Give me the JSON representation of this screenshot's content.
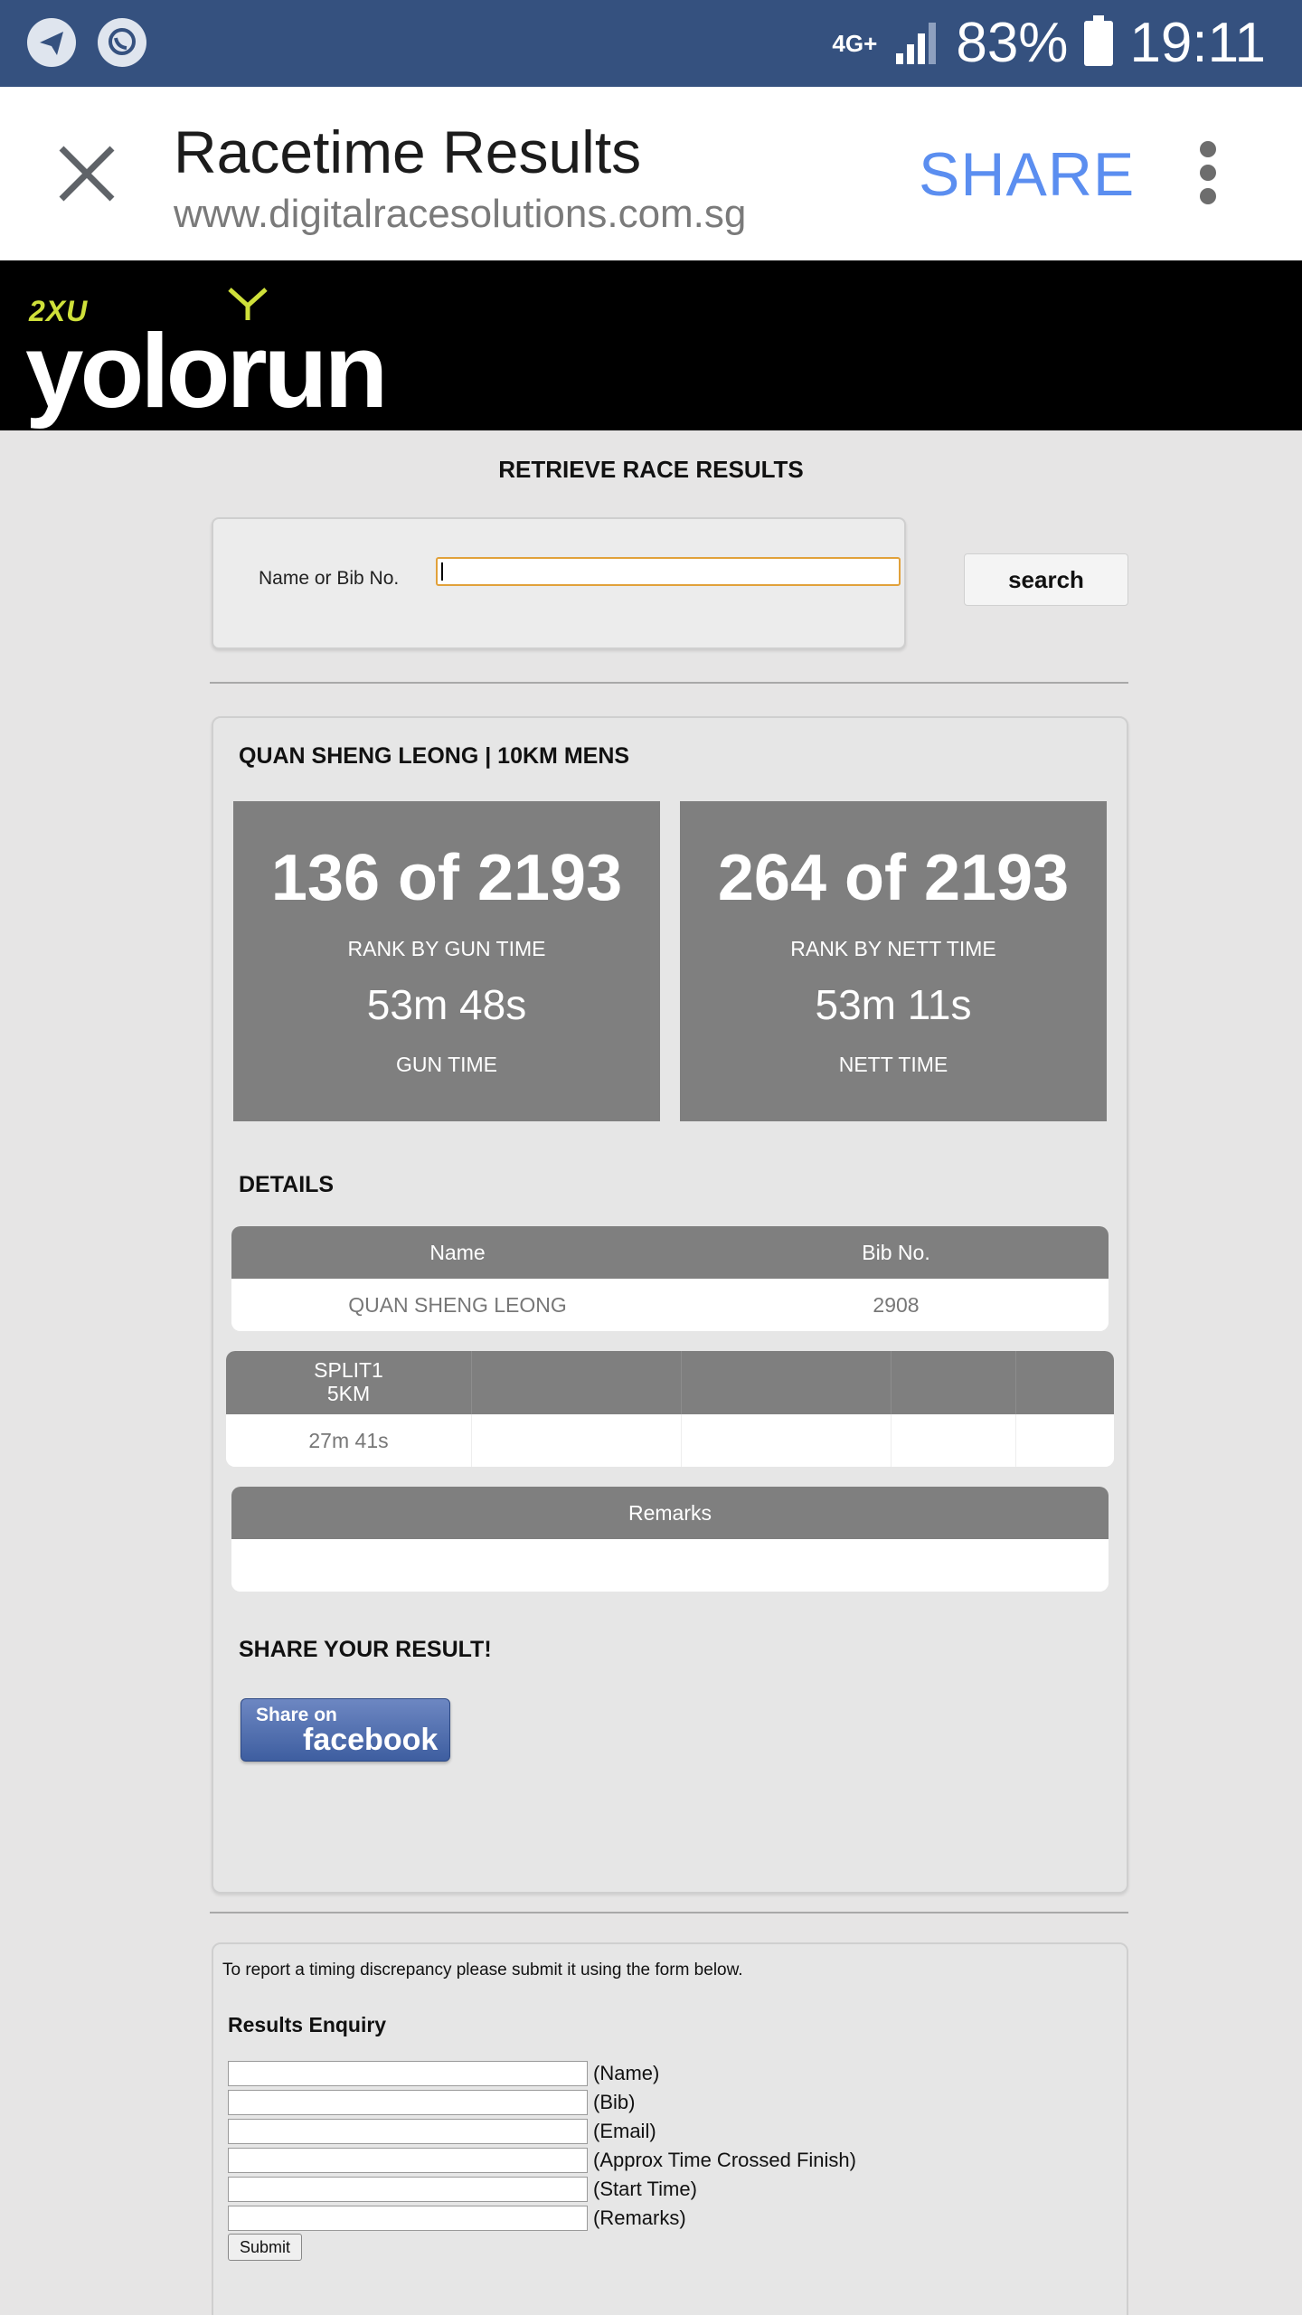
{
  "status_bar": {
    "network": "4G+",
    "battery": "83%",
    "time": "19:11",
    "icons": [
      "telegram-icon",
      "whatsapp-icon",
      "signal-icon",
      "battery-icon"
    ]
  },
  "app_bar": {
    "title": "Racetime Results",
    "url": "www.digitalracesolutions.com.sg",
    "share_label": "SHARE"
  },
  "banner": {
    "logo_brand": "2XU",
    "logo_text": "yolorun"
  },
  "search": {
    "section_title": "RETRIEVE RACE RESULTS",
    "label": "Name or Bib No.",
    "value": "",
    "button_label": "search"
  },
  "result": {
    "heading": "QUAN SHENG LEONG | 10KM MENS",
    "gun": {
      "rank": "136 of 2193",
      "rank_label": "RANK BY GUN TIME",
      "time": "53m 48s",
      "time_label": "GUN TIME"
    },
    "nett": {
      "rank": "264 of 2193",
      "rank_label": "RANK BY NETT TIME",
      "time": "53m 11s",
      "time_label": "NETT TIME"
    },
    "details_title": "DETAILS",
    "details_table": {
      "headers": [
        "Name",
        "Bib No."
      ],
      "row": [
        "QUAN SHENG LEONG",
        "2908"
      ]
    },
    "split_table": {
      "header_line1": "SPLIT1",
      "header_line2": "5KM",
      "value": "27m 41s"
    },
    "remarks_table": {
      "header": "Remarks",
      "value": ""
    },
    "share_title": "SHARE YOUR RESULT!",
    "facebook_button": {
      "top": "Share on",
      "main": "facebook"
    }
  },
  "enquiry": {
    "intro": "To report a timing discrepancy please submit it using the form below.",
    "title": "Results Enquiry",
    "fields": [
      "(Name)",
      "(Bib)",
      "(Email)",
      "(Approx Time Crossed Finish)",
      "(Start Time)",
      "(Remarks)"
    ],
    "submit_label": "Submit"
  }
}
